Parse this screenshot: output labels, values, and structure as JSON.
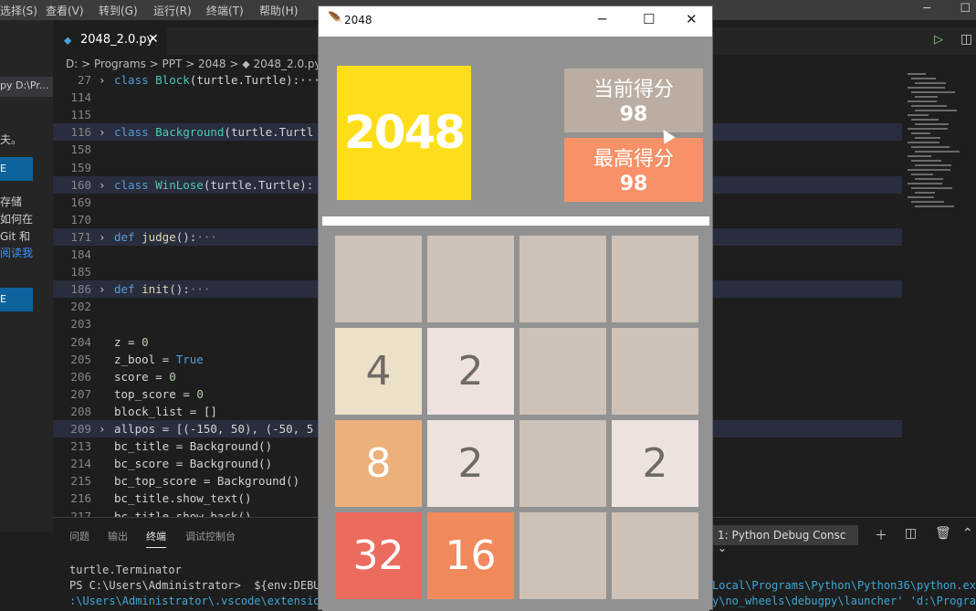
{
  "vscode": {
    "menu": [
      "选择(S)",
      "查看(V)",
      "转到(G)",
      "运行(R)",
      "终端(T)",
      "帮助(H)"
    ],
    "tab": {
      "label": "2048_2.0.py",
      "close": "✕"
    },
    "breadcrumb": "D: > Programs > PPT > 2048 > ⬥ 2048_2.0.py",
    "sidebar": {
      "path": "py  D:\\Pr...",
      "text1": "夫。",
      "btn1": "E",
      "text2": "存储",
      "text3": "如何在",
      "text4": "Git 和",
      "link": "阅读我",
      "btn2": "E"
    },
    "code_lines": [
      {
        "n": "27",
        "fold": true,
        "hl": false,
        "parts": [
          [
            "kw",
            "class "
          ],
          [
            "cls",
            "Block"
          ],
          [
            "",
            "(turtle.Turtle):···"
          ]
        ]
      },
      {
        "n": "114",
        "fold": false,
        "hl": false,
        "parts": []
      },
      {
        "n": "115",
        "fold": false,
        "hl": false,
        "parts": []
      },
      {
        "n": "116",
        "fold": true,
        "hl": true,
        "parts": [
          [
            "kw",
            "class "
          ],
          [
            "cls",
            "Background"
          ],
          [
            "",
            "(turtle.Turtl"
          ]
        ]
      },
      {
        "n": "158",
        "fold": false,
        "hl": false,
        "parts": []
      },
      {
        "n": "159",
        "fold": false,
        "hl": false,
        "parts": []
      },
      {
        "n": "160",
        "fold": true,
        "hl": true,
        "parts": [
          [
            "kw",
            "class "
          ],
          [
            "cls",
            "WinLose"
          ],
          [
            "",
            "(turtle.Turtle):"
          ]
        ]
      },
      {
        "n": "169",
        "fold": false,
        "hl": false,
        "parts": []
      },
      {
        "n": "170",
        "fold": false,
        "hl": false,
        "parts": []
      },
      {
        "n": "171",
        "fold": true,
        "hl": true,
        "parts": [
          [
            "kw",
            "def "
          ],
          [
            "fn",
            "judge"
          ],
          [
            "",
            "():"
          ],
          [
            "dots",
            "···"
          ]
        ]
      },
      {
        "n": "184",
        "fold": false,
        "hl": false,
        "parts": []
      },
      {
        "n": "185",
        "fold": false,
        "hl": false,
        "parts": []
      },
      {
        "n": "186",
        "fold": true,
        "hl": true,
        "parts": [
          [
            "kw",
            "def "
          ],
          [
            "fn",
            "init"
          ],
          [
            "",
            "():"
          ],
          [
            "dots",
            "···"
          ]
        ]
      },
      {
        "n": "202",
        "fold": false,
        "hl": false,
        "parts": []
      },
      {
        "n": "203",
        "fold": false,
        "hl": false,
        "parts": []
      },
      {
        "n": "204",
        "fold": false,
        "hl": false,
        "parts": [
          [
            "",
            "z = "
          ],
          [
            "num",
            "0"
          ]
        ]
      },
      {
        "n": "205",
        "fold": false,
        "hl": false,
        "parts": [
          [
            "",
            "z_bool = "
          ],
          [
            "kw",
            "True"
          ]
        ]
      },
      {
        "n": "206",
        "fold": false,
        "hl": false,
        "parts": [
          [
            "",
            "score = "
          ],
          [
            "num",
            "0"
          ]
        ]
      },
      {
        "n": "207",
        "fold": false,
        "hl": false,
        "parts": [
          [
            "",
            "top_score = "
          ],
          [
            "num",
            "0"
          ]
        ]
      },
      {
        "n": "208",
        "fold": false,
        "hl": false,
        "parts": [
          [
            "",
            "block_list = []"
          ]
        ]
      },
      {
        "n": "209",
        "fold": true,
        "hl": true,
        "parts": [
          [
            "",
            "allpos = [(-150, 50), (-50, 5"
          ]
        ]
      },
      {
        "n": "213",
        "fold": false,
        "hl": false,
        "parts": [
          [
            "",
            "bc_title = Background()"
          ]
        ]
      },
      {
        "n": "214",
        "fold": false,
        "hl": false,
        "parts": [
          [
            "",
            "bc_score = Background()"
          ]
        ]
      },
      {
        "n": "215",
        "fold": false,
        "hl": false,
        "parts": [
          [
            "",
            "bc_top_score = Background()"
          ]
        ]
      },
      {
        "n": "216",
        "fold": false,
        "hl": false,
        "parts": [
          [
            "",
            "bc_title.show_text()"
          ]
        ]
      },
      {
        "n": "217",
        "fold": false,
        "hl": false,
        "parts": [
          [
            "",
            "bc_title.show_back()"
          ]
        ]
      }
    ],
    "panel": {
      "tabs": [
        "问题",
        "输出",
        "终端",
        "调试控制台"
      ],
      "active_tab": "终端",
      "terminal_select": "1: Python Debug Consc ⌄",
      "lines": [
        {
          "a": "turtle.Terminator",
          "b": ""
        },
        {
          "a": "PS C:\\Users\\Administrator>  ${env:DEBU",
          "b": "Local\\Programs\\Python\\Python36\\python.exe"
        },
        {
          "a": ":\\Users\\Administrator\\.vscode\\extension",
          "b": "y\\no_wheels\\debugpy\\launcher' 'd:\\Program"
        }
      ]
    }
  },
  "game": {
    "window_title": "2048",
    "logo": "2048",
    "current_label": "当前得分",
    "current_score": "98",
    "top_label": "最高得分",
    "top_score": "98",
    "tiles": [
      [
        "",
        "",
        "",
        ""
      ],
      [
        "4",
        "2",
        "",
        ""
      ],
      [
        "8",
        "2",
        "",
        "2"
      ],
      [
        "32",
        "16",
        "",
        ""
      ]
    ],
    "colors": {
      "empty": "#cdc1b8",
      "2": "#eee2de",
      "4": "#ede0c8",
      "8": "#ecb17b",
      "16": "#f08a5c",
      "32": "#ec6b5f",
      "logo": "#fede1a",
      "current_box": "#bbada2",
      "top_box": "#f89168"
    }
  }
}
